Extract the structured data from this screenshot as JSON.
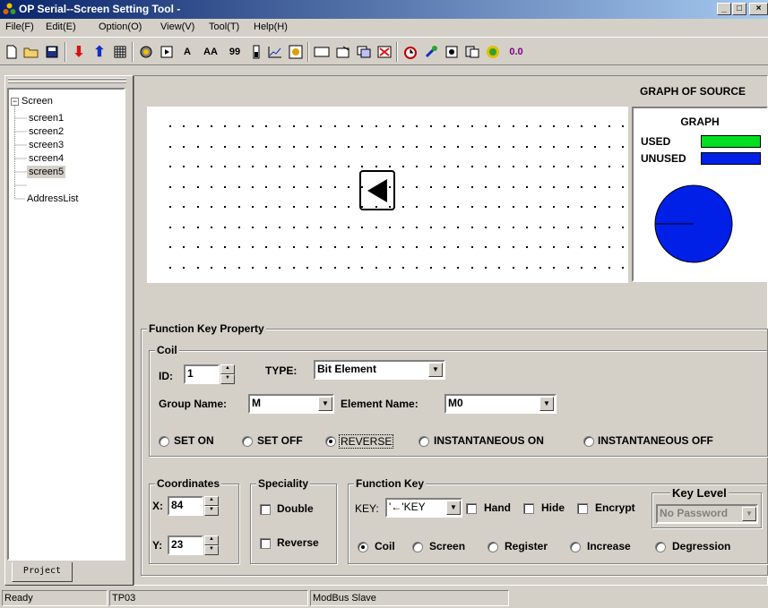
{
  "title": "OP Serial--Screen Setting Tool -",
  "window_buttons": {
    "minimize": "_",
    "maximize": "□",
    "close": "×"
  },
  "menu": [
    "File(F)",
    "Edit(E)",
    "Option(O)",
    "View(V)",
    "Tool(T)",
    "Help(H)"
  ],
  "toolbar": {
    "text_a": "A",
    "text_aa": "AA",
    "text_99": "99",
    "zero_label": "0.0",
    "icons": [
      "new-icon",
      "open-icon",
      "save-icon",
      "download-icon",
      "upload-icon",
      "calendar-icon",
      "disc-icon",
      "play-icon",
      "text-icon",
      "double-text-icon",
      "number-icon",
      "bar-icon",
      "trend-icon",
      "chart-icon",
      "rectangle-icon",
      "window-icon",
      "copy-screen-icon",
      "delete-screen-icon",
      "alarm-icon",
      "wrench-icon",
      "record-icon",
      "paste-icon",
      "gear-icon"
    ]
  },
  "tree": {
    "root": "Screen",
    "toggle": "−",
    "items": [
      "screen1",
      "screen2",
      "screen3",
      "screen4",
      "screen5"
    ],
    "selected": "screen5",
    "address_list": "AddressList"
  },
  "project_tab": "Project",
  "graph": {
    "source_title": "GRAPH OF SOURCE",
    "box_title": "GRAPH",
    "used_label": "USED",
    "unused_label": "UNUSED",
    "used_color": "#00e020",
    "unused_color": "#0020e8"
  },
  "function_key_property": {
    "title": "Function Key Property",
    "coil": {
      "title": "Coil",
      "id_label": "ID:",
      "id_value": "1",
      "type_label": "TYPE:",
      "type_value": "Bit Element",
      "group_label": "Group Name:",
      "group_value": "M",
      "element_label": "Element Name:",
      "element_value": "M0",
      "modes": [
        "SET ON",
        "SET OFF",
        "REVERSE",
        "INSTANTANEOUS ON",
        "INSTANTANEOUS OFF"
      ],
      "selected_mode": "REVERSE"
    },
    "coordinates": {
      "title": "Coordinates",
      "x_label": "X:",
      "x_value": "84",
      "y_label": "Y:",
      "y_value": "23"
    },
    "speciality": {
      "title": "Speciality",
      "double": "Double",
      "reverse": "Reverse"
    },
    "function_key": {
      "title": "Function Key",
      "key_label": "KEY:",
      "key_value": "'←'KEY",
      "hand": "Hand",
      "hide": "Hide",
      "encrypt": "Encrypt",
      "types": [
        "Coil",
        "Screen",
        "Register",
        "Increase",
        "Degression"
      ],
      "selected_type": "Coil"
    },
    "key_level": {
      "title": "Key Level",
      "value": "No Password"
    }
  },
  "statusbar": [
    "Ready",
    "TP03",
    "ModBus Slave"
  ]
}
